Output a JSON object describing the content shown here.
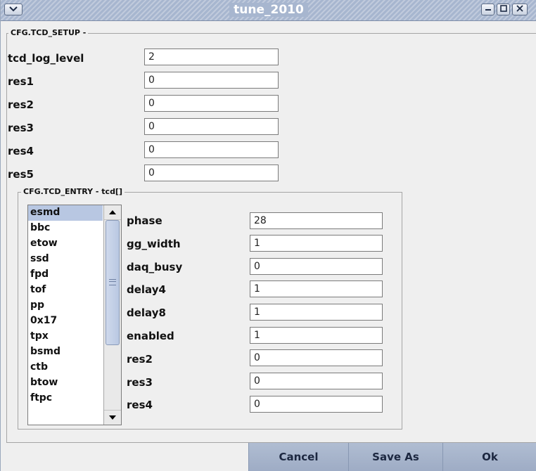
{
  "window": {
    "title": "tune_2010",
    "buttons": {
      "menu_icon": "chevron-down-icon",
      "minimize_icon": "minimize-icon",
      "maximize_icon": "maximize-icon",
      "close_icon": "close-icon"
    }
  },
  "setup": {
    "title": "CFG.TCD_SETUP -",
    "fields": [
      {
        "label": "tcd_log_level",
        "value": "2"
      },
      {
        "label": "res1",
        "value": "0"
      },
      {
        "label": "res2",
        "value": "0"
      },
      {
        "label": "res3",
        "value": "0"
      },
      {
        "label": "res4",
        "value": "0"
      },
      {
        "label": "res5",
        "value": "0"
      }
    ]
  },
  "entry": {
    "title": "CFG.TCD_ENTRY - tcd[]",
    "list": {
      "items": [
        "esmd",
        "bbc",
        "etow",
        "ssd",
        "fpd",
        "tof",
        "pp",
        "0x17",
        "tpx",
        "bsmd",
        "ctb",
        "btow",
        "ftpc"
      ],
      "selected": "esmd"
    },
    "fields": [
      {
        "label": "phase",
        "value": "28"
      },
      {
        "label": "gg_width",
        "value": "1"
      },
      {
        "label": "daq_busy",
        "value": "0"
      },
      {
        "label": "delay4",
        "value": "1"
      },
      {
        "label": "delay8",
        "value": "1"
      },
      {
        "label": "enabled",
        "value": "1"
      },
      {
        "label": "res2",
        "value": "0"
      },
      {
        "label": "res3",
        "value": "0"
      },
      {
        "label": "res4",
        "value": "0"
      }
    ]
  },
  "buttons": {
    "cancel": "Cancel",
    "save_as": "Save As",
    "ok": "Ok"
  }
}
